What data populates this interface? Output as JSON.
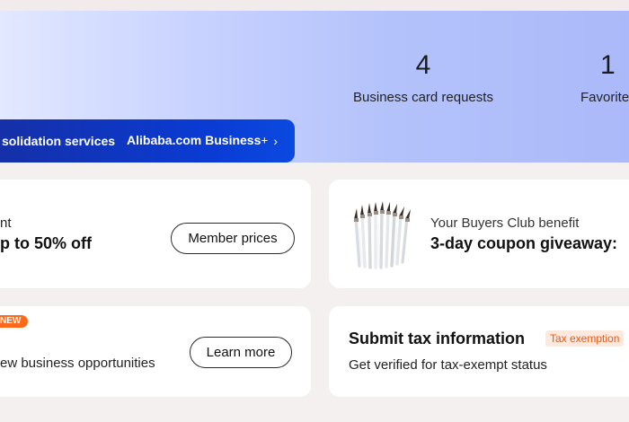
{
  "stats": [
    {
      "number": "4",
      "label": "Business card requests"
    },
    {
      "number": "1",
      "label": "Favorites"
    }
  ],
  "banner": {
    "left_text": "solidation services a...",
    "brand_text": "Alibaba.com Business",
    "brand_plus": "+",
    "chevron": "›"
  },
  "member_card": {
    "small_text": "nt",
    "big_text": "p to 50% off",
    "button_label": "Member prices"
  },
  "buyers_club_card": {
    "image_icon": "paint-brushes-image",
    "small_text": "Your Buyers Club benefit",
    "big_text": "3-day coupon giveaway:"
  },
  "opportunities_card": {
    "badge": "NEW",
    "description": "ew business opportunities",
    "button_label": "Learn more"
  },
  "tax_card": {
    "title": "Submit tax information",
    "tag": "Tax exemption",
    "description": "Get verified for tax-exempt status"
  },
  "colors": {
    "banner_blue": "#0a3bd3",
    "badge_orange": "#ff6a1a",
    "tag_orange": "#ea5a18"
  }
}
